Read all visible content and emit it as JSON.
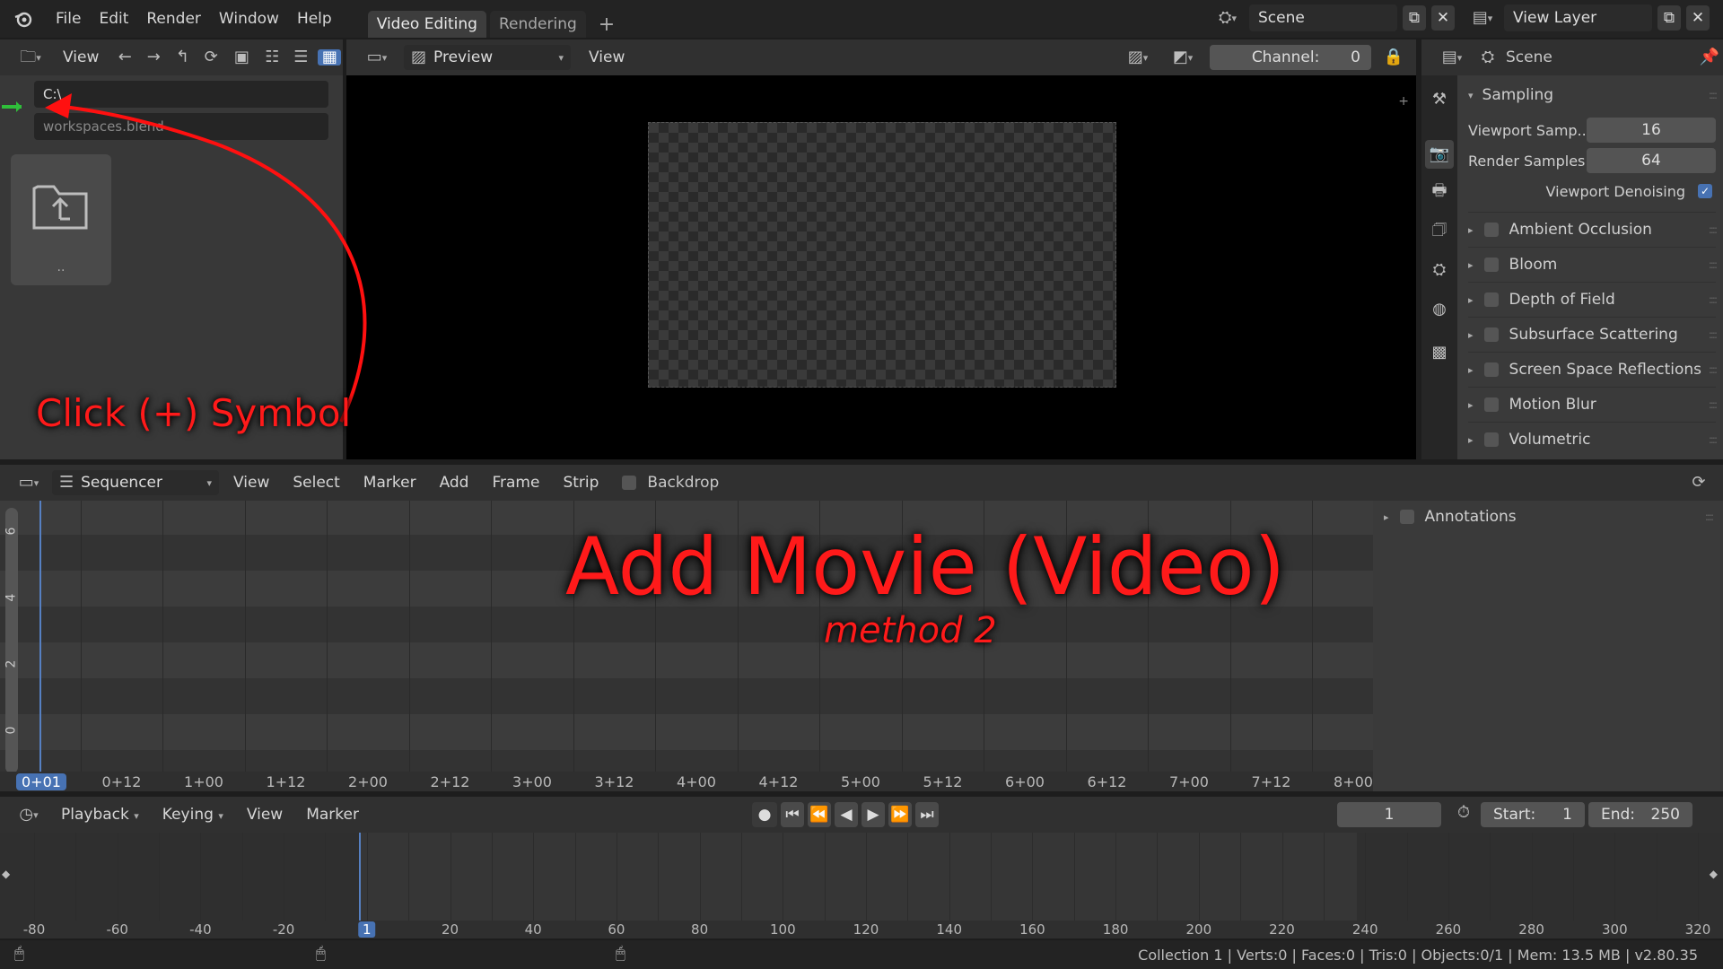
{
  "topbar": {
    "menus": [
      "File",
      "Edit",
      "Render",
      "Window",
      "Help"
    ],
    "workspaces": [
      {
        "label": "Video Editing",
        "active": true
      },
      {
        "label": "Rendering",
        "active": false
      }
    ],
    "add_label": "+",
    "scene_name": "Scene",
    "view_layer_name": "View Layer"
  },
  "filebrowser": {
    "view_label": "View",
    "path": "C:\\",
    "filename": "workspaces.blend",
    "parent_label": ".."
  },
  "preview": {
    "mode_label": "Preview",
    "view_label": "View",
    "channel_label": "Channel:",
    "channel_value": "0"
  },
  "properties": {
    "context_label": "Scene",
    "section": "Sampling",
    "rows": [
      {
        "label": "Viewport Samp..",
        "value": "16"
      },
      {
        "label": "Render Samples",
        "value": "64"
      }
    ],
    "denoise_label": "Viewport Denoising",
    "denoise_checked": true,
    "panels": [
      "Ambient Occlusion",
      "Bloom",
      "Depth of Field",
      "Subsurface Scattering",
      "Screen Space Reflections",
      "Motion Blur",
      "Volumetric"
    ]
  },
  "sequencer": {
    "type_label": "Sequencer",
    "menus": [
      "View",
      "Select",
      "Marker",
      "Add",
      "Frame",
      "Strip"
    ],
    "backdrop_label": "Backdrop",
    "annotations_label": "Annotations",
    "channel_ticks": [
      "6",
      "4",
      "2",
      "0"
    ],
    "time_ticks": [
      "0+01",
      "0+12",
      "1+00",
      "1+12",
      "2+00",
      "2+12",
      "3+00",
      "3+12",
      "4+00",
      "4+12",
      "5+00",
      "5+12",
      "6+00",
      "6+12",
      "7+00",
      "7+12",
      "8+00"
    ]
  },
  "overlay": {
    "title": "Add Movie (Video)",
    "subtitle": "method 2",
    "callout": "Click (+) Symbol",
    "color": "#ff0000"
  },
  "timeline": {
    "menus": [
      "Playback",
      "Keying",
      "View",
      "Marker"
    ],
    "current_frame": "1",
    "start_label": "Start:",
    "start_value": "1",
    "end_label": "End:",
    "end_value": "250",
    "ticks": [
      "-80",
      "-60",
      "-40",
      "-20",
      "1",
      "20",
      "40",
      "60",
      "80",
      "100",
      "120",
      "140",
      "160",
      "180",
      "200",
      "220",
      "240",
      "260",
      "280",
      "300",
      "320"
    ]
  },
  "statusbar": {
    "info": "Collection 1 | Verts:0 | Faces:0 | Tris:0 | Objects:0/1 | Mem: 13.5 MB | v2.80.35"
  },
  "colors": {
    "accent": "#4772b3",
    "overlay": "#ff0000"
  }
}
